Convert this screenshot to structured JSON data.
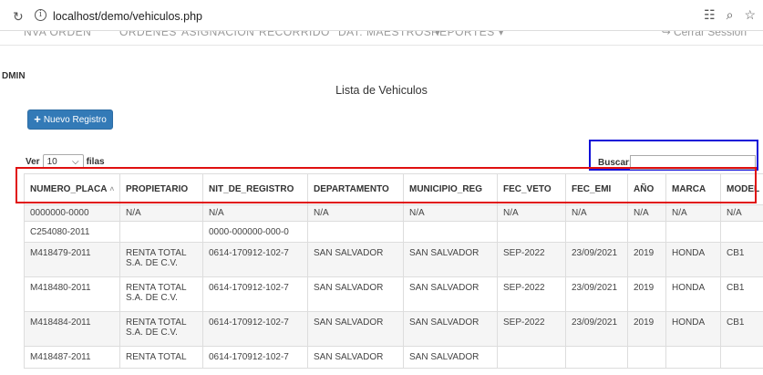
{
  "browser": {
    "url": "localhost/demo/vehiculos.php",
    "reload_icon": "reload-icon",
    "info_icon": "info-icon"
  },
  "nav": {
    "items": [
      "NVA ORDEN",
      "ORDENES",
      "ASIGNACION",
      "RECORRIDO",
      "DAT. MAESTROS ▾",
      "REPORTES ▾"
    ],
    "logout": "↪ Cerrar Session"
  },
  "user_label": "DMIN",
  "page_title": "Lista de Vehiculos",
  "new_button": {
    "label": "Nuevo Registro",
    "icon": "plus-icon"
  },
  "length": {
    "prefix": "Ver",
    "value": "10",
    "suffix": "filas"
  },
  "search": {
    "label": "Buscar:",
    "value": ""
  },
  "colors": {
    "primary": "#337ab7",
    "highlight_red": "#e01010",
    "highlight_blue": "#1010d8"
  },
  "table": {
    "columns": [
      "NUMERO_PLACA",
      "PROPIETARIO",
      "NIT_DE_REGISTRO",
      "DEPARTAMENTO",
      "MUNICIPIO_REG",
      "FEC_VETO",
      "FEC_EMI",
      "AÑO",
      "MARCA",
      "MODEL"
    ],
    "rows": [
      [
        "0000000-0000",
        "N/A",
        "N/A",
        "N/A",
        "N/A",
        "N/A",
        "N/A",
        "N/A",
        "N/A",
        "N/A"
      ],
      [
        "C254080-2011",
        "",
        "0000-000000-000-0",
        "",
        "",
        "",
        "",
        "",
        "",
        ""
      ],
      [
        "M418479-2011",
        "RENTA TOTAL S.A. DE C.V.",
        "0614-170912-102-7",
        "SAN SALVADOR",
        "SAN SALVADOR",
        "SEP-2022",
        "23/09/2021",
        "2019",
        "HONDA",
        "CB1"
      ],
      [
        "M418480-2011",
        "RENTA TOTAL S.A. DE C.V.",
        "0614-170912-102-7",
        "SAN SALVADOR",
        "SAN SALVADOR",
        "SEP-2022",
        "23/09/2021",
        "2019",
        "HONDA",
        "CB1"
      ],
      [
        "M418484-2011",
        "RENTA TOTAL S.A. DE C.V.",
        "0614-170912-102-7",
        "SAN SALVADOR",
        "SAN SALVADOR",
        "SEP-2022",
        "23/09/2021",
        "2019",
        "HONDA",
        "CB1"
      ],
      [
        "M418487-2011",
        "RENTA TOTAL",
        "0614-170912-102-7",
        "SAN SALVADOR",
        "SAN SALVADOR",
        "",
        "",
        "",
        "",
        ""
      ]
    ]
  }
}
